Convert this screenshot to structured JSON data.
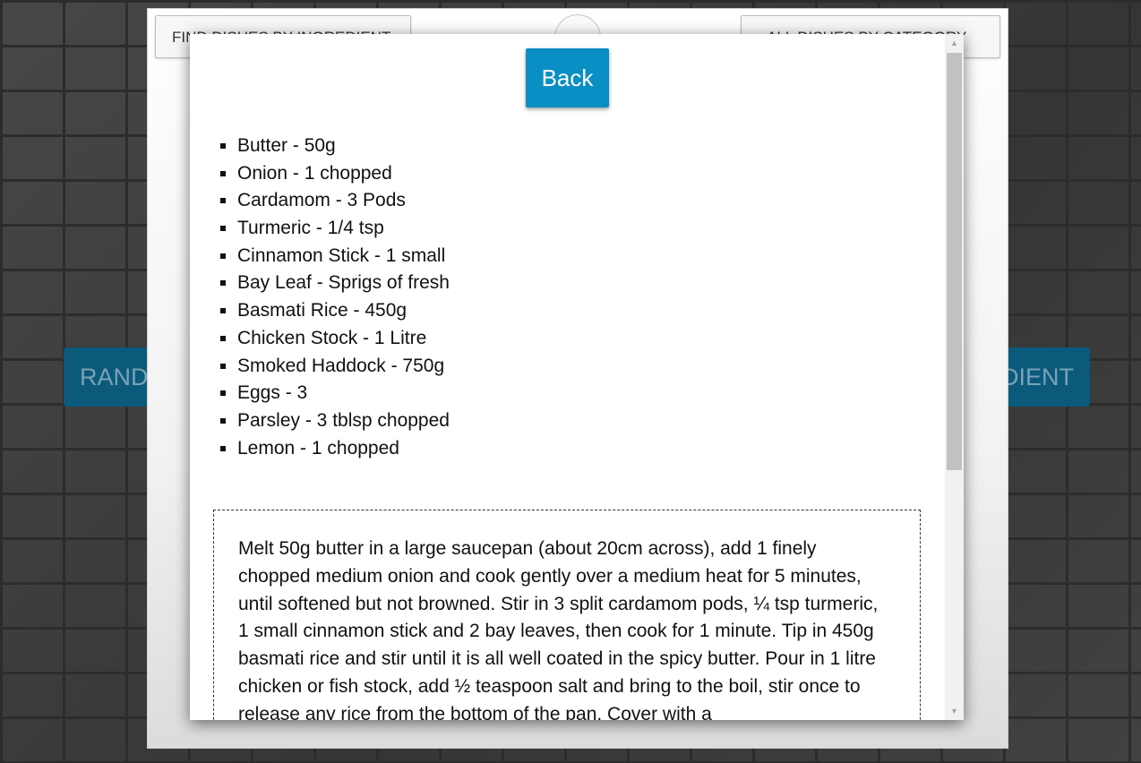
{
  "background": {
    "left_button_label": "RAND",
    "right_button_label": "DIENT"
  },
  "panel": {
    "tab_left_label": "FIND DISHES BY INGREDIENT",
    "tab_right_label": "ALL DISHES BY CATEGORY",
    "center_icon": "chevron-down-icon"
  },
  "modal": {
    "back_label": "Back",
    "ingredients": [
      "Butter - 50g",
      "Onion - 1 chopped",
      "Cardamom - 3 Pods",
      "Turmeric - 1/4 tsp",
      "Cinnamon Stick - 1 small",
      "Bay Leaf - Sprigs of fresh",
      "Basmati Rice - 450g",
      "Chicken Stock - 1 Litre",
      "Smoked Haddock - 750g",
      "Eggs - 3",
      "Parsley - 3 tblsp chopped",
      "Lemon - 1 chopped"
    ],
    "instructions": "Melt 50g butter in a large saucepan (about 20cm across), add 1 finely chopped medium onion and cook gently over a medium heat for 5 minutes, until softened but not browned. Stir in 3 split cardamom pods, ¼ tsp turmeric, 1 small cinnamon stick and 2 bay leaves, then cook for 1 minute. Tip in 450g basmati rice and stir until it is all well coated in the spicy butter. Pour in 1 litre chicken or fish stock, add ½ teaspoon salt and bring to the boil, stir once to release any rice from the bottom of the pan. Cover with a"
  },
  "colors": {
    "accent": "#0a8fc4",
    "background_button": "#0b5a7c"
  }
}
